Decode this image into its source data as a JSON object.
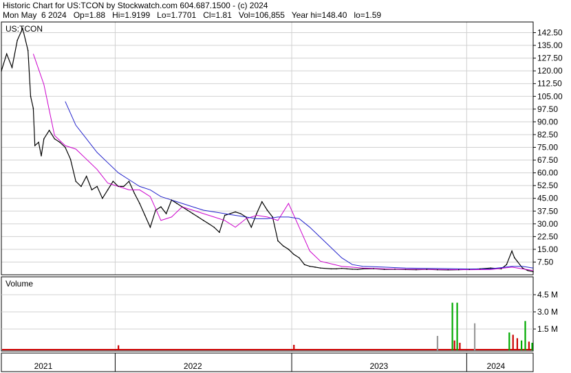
{
  "header": {
    "line1": "Historic Chart for US:TCON by Stockwatch.com 604.687.1500 - (c) 2024",
    "line2": "Mon May  6 2024   Op=1.88   Hi=1.9199   Lo=1.7701   Cl=1.81   Vol=106,855   Year hi=148.40   lo=1.59"
  },
  "colors": {
    "price": "#000000",
    "ma_fast": "#cc00cc",
    "ma_slow": "#2222cc",
    "volume_up": "#00aa00",
    "volume_down": "#cc0000",
    "volume_neutral": "#999999",
    "grid": "#d0d0d0",
    "frame": "#000000"
  },
  "chart_data": [
    {
      "type": "line",
      "panel": "price",
      "title": "US:TCON",
      "y_ticks": [
        "142.50",
        "135.00",
        "127.50",
        "120.00",
        "112.50",
        "105.00",
        "97.50",
        "90.00",
        "82.50",
        "75.00",
        "67.50",
        "60.00",
        "52.50",
        "45.00",
        "37.50",
        "30.00",
        "22.50",
        "15.00",
        "7.50"
      ],
      "ylim": [
        0,
        148.4
      ],
      "x_labels": [
        "2021",
        "2022",
        "2023",
        "2024"
      ],
      "grid": true,
      "series": [
        {
          "role": "price",
          "x": [
            0,
            0.01,
            0.02,
            0.03,
            0.04,
            0.05,
            0.055,
            0.06,
            0.063,
            0.07,
            0.075,
            0.08,
            0.09,
            0.1,
            0.11,
            0.12,
            0.13,
            0.14,
            0.15,
            0.16,
            0.17,
            0.18,
            0.19,
            0.2,
            0.21,
            0.22,
            0.23,
            0.24,
            0.25,
            0.26,
            0.27,
            0.28,
            0.29,
            0.3,
            0.31,
            0.32,
            0.33,
            0.34,
            0.35,
            0.36,
            0.37,
            0.38,
            0.39,
            0.4,
            0.41,
            0.42,
            0.43,
            0.44,
            0.45,
            0.46,
            0.47,
            0.48,
            0.49,
            0.5,
            0.51,
            0.52,
            0.53,
            0.54,
            0.55,
            0.56,
            0.57,
            0.58,
            0.59,
            0.6,
            0.62,
            0.63,
            0.64,
            0.65,
            0.66,
            0.67,
            0.68,
            0.7,
            0.72,
            0.74,
            0.76,
            0.78,
            0.8,
            0.82,
            0.84,
            0.86,
            0.88,
            0.9,
            0.92,
            0.94,
            0.95,
            0.96,
            0.965,
            0.97,
            0.98,
            0.99,
            1.0
          ],
          "values": [
            120,
            130,
            122,
            138,
            145,
            132,
            105,
            98,
            76,
            78,
            70,
            80,
            85,
            80,
            78,
            75,
            68,
            55,
            52,
            58,
            50,
            52,
            45,
            50,
            55,
            52,
            52,
            55,
            48,
            42,
            35,
            28,
            38,
            40,
            36,
            44,
            42,
            40,
            38,
            36,
            34,
            32,
            30,
            28,
            25,
            35,
            36,
            37,
            36,
            34,
            28,
            36,
            43,
            38,
            34,
            20,
            17,
            15,
            12,
            10,
            6,
            5,
            4.5,
            4,
            3.5,
            3.5,
            3.8,
            3.5,
            3.3,
            3.2,
            3.5,
            3.6,
            3.2,
            3.3,
            3.1,
            3.0,
            3.2,
            3.0,
            2.9,
            3.0,
            3.2,
            3.5,
            4,
            3.5,
            6,
            14,
            10,
            8,
            4,
            2.5,
            1.81
          ]
        },
        {
          "role": "ma_fast",
          "x": [
            0.06,
            0.08,
            0.1,
            0.12,
            0.14,
            0.16,
            0.18,
            0.2,
            0.22,
            0.24,
            0.26,
            0.28,
            0.3,
            0.32,
            0.34,
            0.36,
            0.38,
            0.4,
            0.42,
            0.44,
            0.46,
            0.48,
            0.5,
            0.52,
            0.54,
            0.56,
            0.58,
            0.6,
            0.64,
            0.68,
            0.72,
            0.76,
            0.8,
            0.84,
            0.88,
            0.92,
            0.96,
            0.98,
            1.0
          ],
          "values": [
            130,
            112,
            82,
            76,
            74,
            68,
            62,
            54,
            52,
            50,
            50,
            46,
            32,
            34,
            40,
            38,
            36,
            34,
            32,
            28,
            33,
            35,
            34,
            32,
            42,
            28,
            14,
            8,
            5,
            4,
            3.5,
            3.3,
            3.2,
            3.1,
            3.0,
            3.1,
            4.5,
            3.5,
            2.5
          ]
        },
        {
          "role": "ma_slow",
          "x": [
            0.12,
            0.14,
            0.16,
            0.18,
            0.2,
            0.22,
            0.24,
            0.26,
            0.28,
            0.3,
            0.32,
            0.34,
            0.36,
            0.38,
            0.4,
            0.42,
            0.44,
            0.46,
            0.48,
            0.5,
            0.52,
            0.54,
            0.56,
            0.58,
            0.6,
            0.62,
            0.64,
            0.66,
            0.68,
            0.72,
            0.76,
            0.8,
            0.84,
            0.88,
            0.92,
            0.96,
            0.98,
            1.0
          ],
          "values": [
            102,
            88,
            80,
            72,
            66,
            60,
            56,
            52,
            50,
            46,
            44,
            42,
            40,
            38,
            37,
            36,
            35,
            34,
            33,
            33,
            34,
            34,
            33,
            28,
            22,
            16,
            10,
            6,
            5,
            4.5,
            4,
            3.8,
            3.6,
            3.4,
            3.5,
            5,
            5,
            4
          ]
        }
      ]
    },
    {
      "type": "bar",
      "panel": "volume",
      "title": "Volume",
      "y_ticks": [
        "4.5 M",
        "3.0 M",
        "1.5 M"
      ],
      "ylim": [
        0,
        5.4
      ],
      "bars": [
        {
          "x": 0.22,
          "value": 0.08,
          "dir": "down"
        },
        {
          "x": 0.55,
          "value": 0.12,
          "dir": "down"
        },
        {
          "x": 0.82,
          "value": 0.9,
          "dir": "neutral"
        },
        {
          "x": 0.848,
          "value": 3.8,
          "dir": "up"
        },
        {
          "x": 0.852,
          "value": 0.5,
          "dir": "down"
        },
        {
          "x": 0.857,
          "value": 3.8,
          "dir": "up"
        },
        {
          "x": 0.862,
          "value": 0.3,
          "dir": "down"
        },
        {
          "x": 0.89,
          "value": 2.0,
          "dir": "neutral"
        },
        {
          "x": 0.955,
          "value": 1.2,
          "dir": "up"
        },
        {
          "x": 0.962,
          "value": 1.0,
          "dir": "down"
        },
        {
          "x": 0.97,
          "value": 0.7,
          "dir": "down"
        },
        {
          "x": 0.978,
          "value": 0.5,
          "dir": "up"
        },
        {
          "x": 0.985,
          "value": 2.2,
          "dir": "up"
        },
        {
          "x": 0.992,
          "value": 0.4,
          "dir": "down"
        },
        {
          "x": 0.998,
          "value": 0.3,
          "dir": "up"
        }
      ]
    }
  ]
}
